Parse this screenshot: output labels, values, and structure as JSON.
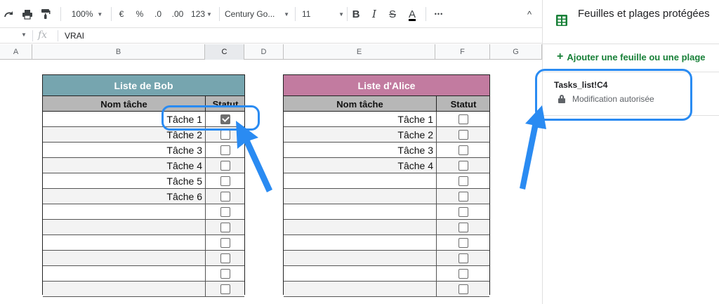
{
  "toolbar": {
    "zoom": "100%",
    "currency": "€",
    "percent": "%",
    "decrease_decimals": ".0",
    "increase_decimals": ".00",
    "number_format": "123",
    "font_family": "Century Go...",
    "font_size": "11",
    "bold": "B",
    "italic": "I",
    "strike": "S",
    "text_color": "A",
    "more": "•••",
    "collapse": "^"
  },
  "formula_bar": {
    "fx": "fx",
    "value": "VRAI"
  },
  "columns": [
    "A",
    "B",
    "C",
    "D",
    "E",
    "F",
    "G"
  ],
  "bob_table": {
    "title": "Liste de Bob",
    "title_color": "#76a5af",
    "col_name": "Nom tâche",
    "col_status": "Statut",
    "rows": [
      {
        "name": "Tâche 1",
        "checked": true
      },
      {
        "name": "Tâche 2",
        "checked": false
      },
      {
        "name": "Tâche 3",
        "checked": false
      },
      {
        "name": "Tâche 4",
        "checked": false
      },
      {
        "name": "Tâche 5",
        "checked": false
      },
      {
        "name": "Tâche 6",
        "checked": false
      },
      {
        "name": "",
        "checked": false
      },
      {
        "name": "",
        "checked": false
      },
      {
        "name": "",
        "checked": false
      },
      {
        "name": "",
        "checked": false
      },
      {
        "name": "",
        "checked": false
      },
      {
        "name": "",
        "checked": false
      }
    ]
  },
  "alice_table": {
    "title": "Liste d'Alice",
    "title_color": "#c27ba0",
    "col_name": "Nom tâche",
    "col_status": "Statut",
    "rows": [
      {
        "name": "Tâche 1",
        "checked": false
      },
      {
        "name": "Tâche 2",
        "checked": false
      },
      {
        "name": "Tâche 3",
        "checked": false
      },
      {
        "name": "Tâche 4",
        "checked": false
      },
      {
        "name": "",
        "checked": false
      },
      {
        "name": "",
        "checked": false
      },
      {
        "name": "",
        "checked": false
      },
      {
        "name": "",
        "checked": false
      },
      {
        "name": "",
        "checked": false
      },
      {
        "name": "",
        "checked": false
      },
      {
        "name": "",
        "checked": false
      },
      {
        "name": "",
        "checked": false
      }
    ]
  },
  "side_panel": {
    "title": "Feuilles et plages protégées",
    "add_label": "Ajouter une feuille ou une plage",
    "range_name": "Tasks_list!C4",
    "permission": "Modification autorisée",
    "accent_color": "#188038",
    "icon": "sheets-table-icon"
  },
  "annotation_color": "#2a8bf2"
}
